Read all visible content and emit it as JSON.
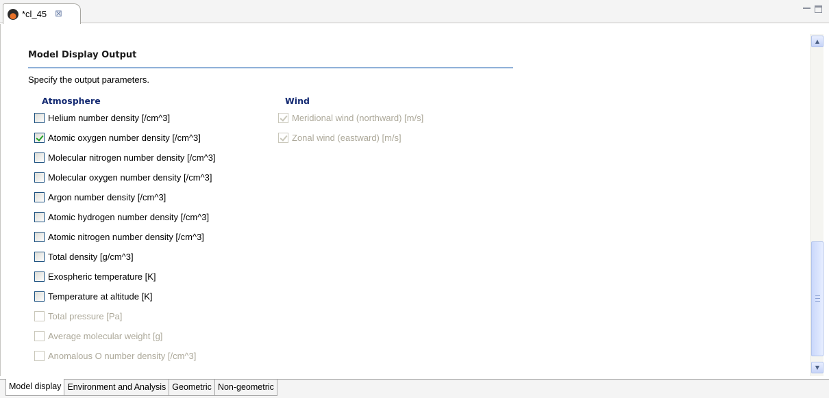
{
  "editor": {
    "tab_title": "*cl_45",
    "tab_icon": "globe-icon",
    "close_glyph": "⊠"
  },
  "form": {
    "section_title": "Model Display Output",
    "section_description": "Specify the output parameters.",
    "atmosphere": {
      "heading": "Atmosphere",
      "items": [
        {
          "label": "Helium number density [/cm^3]",
          "checked": false,
          "enabled": true
        },
        {
          "label": "Atomic oxygen number density [/cm^3]",
          "checked": true,
          "enabled": true
        },
        {
          "label": "Molecular nitrogen number density [/cm^3]",
          "checked": false,
          "enabled": true
        },
        {
          "label": "Molecular oxygen number density [/cm^3]",
          "checked": false,
          "enabled": true
        },
        {
          "label": "Argon number density [/cm^3]",
          "checked": false,
          "enabled": true
        },
        {
          "label": "Atomic hydrogen number density [/cm^3]",
          "checked": false,
          "enabled": true
        },
        {
          "label": "Atomic nitrogen number density [/cm^3]",
          "checked": false,
          "enabled": true
        },
        {
          "label": "Total density [g/cm^3]",
          "checked": false,
          "enabled": true
        },
        {
          "label": "Exospheric temperature [K]",
          "checked": false,
          "enabled": true
        },
        {
          "label": "Temperature at altitude [K]",
          "checked": false,
          "enabled": true
        },
        {
          "label": "Total pressure [Pa]",
          "checked": false,
          "enabled": false
        },
        {
          "label": "Average molecular weight [g]",
          "checked": false,
          "enabled": false
        },
        {
          "label": "Anomalous O number density [/cm^3]",
          "checked": false,
          "enabled": false
        }
      ]
    },
    "wind": {
      "heading": "Wind",
      "items": [
        {
          "label": "Meridional wind (northward) [m/s]",
          "checked": true,
          "enabled": false
        },
        {
          "label": "Zonal wind (eastward) [m/s]",
          "checked": true,
          "enabled": false
        }
      ]
    }
  },
  "page_tabs": [
    {
      "label": "Model display",
      "active": true
    },
    {
      "label": "Environment and Analysis",
      "active": false
    },
    {
      "label": "Geometric",
      "active": false
    },
    {
      "label": "Non-geometric",
      "active": false
    }
  ],
  "colors": {
    "accent_rule": "#8fb0d8",
    "group_heading": "#142a72",
    "checkmark": "#21a121",
    "disabled_text": "#aca899"
  }
}
